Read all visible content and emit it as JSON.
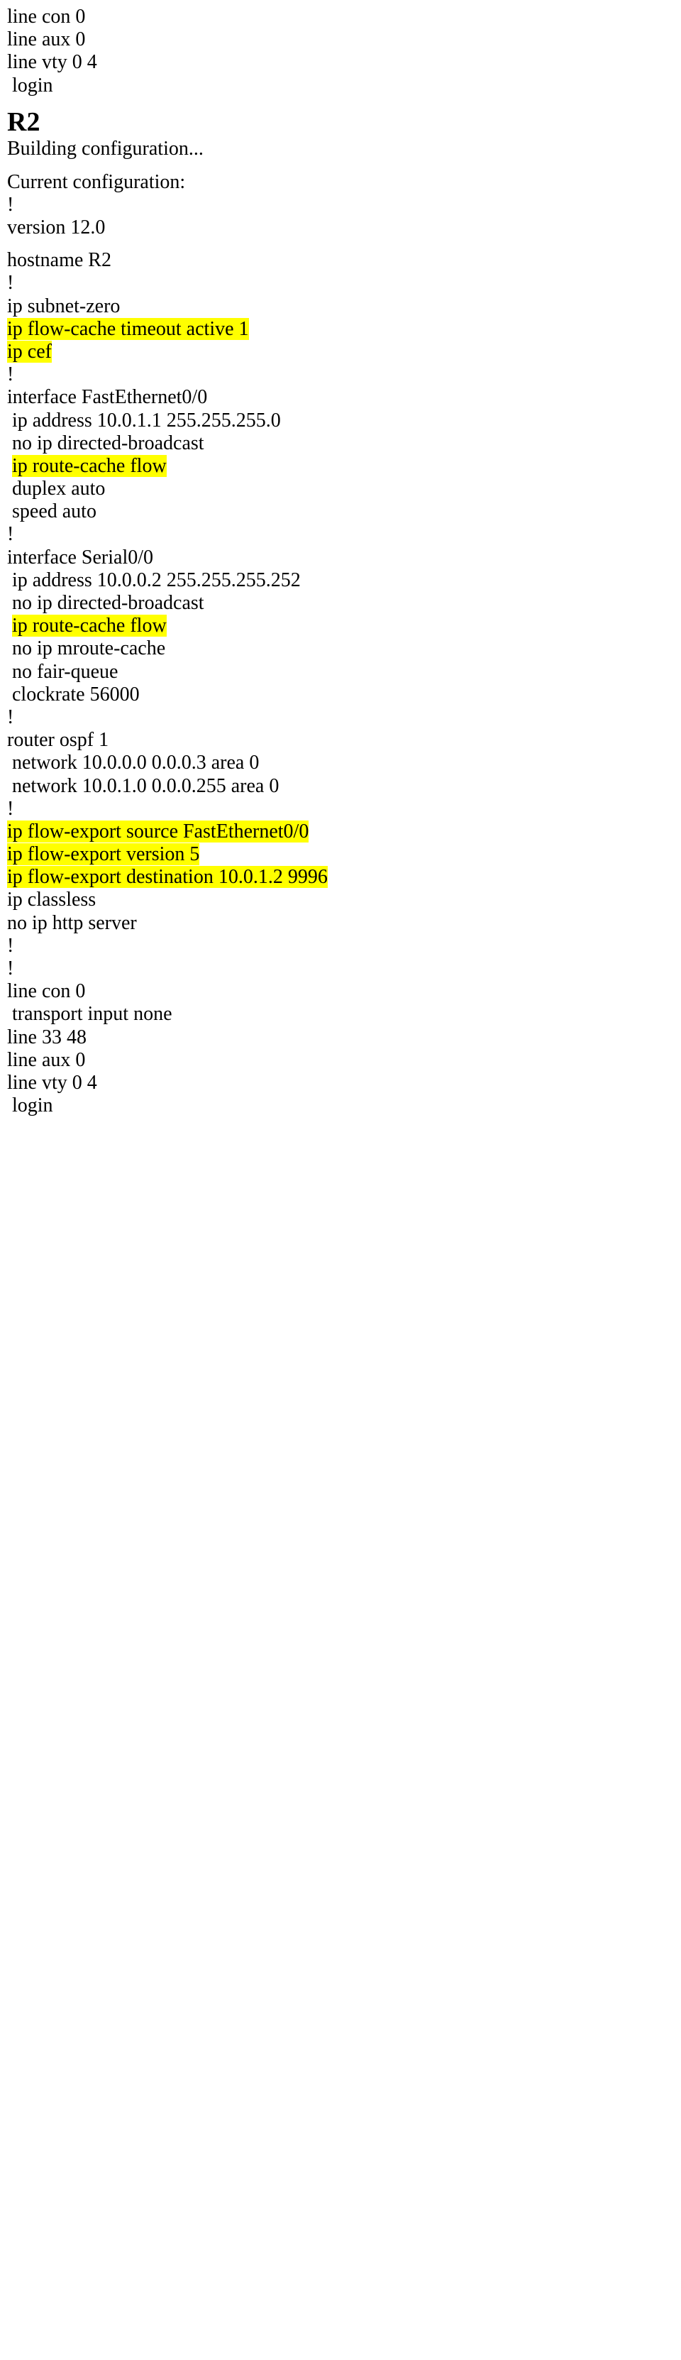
{
  "lines": {
    "l1": "line con 0",
    "l2": "line aux 0",
    "l3": "line vty 0 4",
    "l4": " login",
    "r2": "R2",
    "l5": "Building configuration...",
    "l6": "Current configuration:",
    "l7": "!",
    "l8": "version 12.0",
    "l9": "hostname R2",
    "l10": "!",
    "l11": "ip subnet-zero",
    "l12": "ip flow-cache timeout active 1",
    "l13": "ip cef",
    "l14": "!",
    "l15": "interface FastEthernet0/0",
    "l16": " ip address 10.0.1.1 255.255.255.0",
    "l17": " no ip directed-broadcast",
    "l18_pre": " ",
    "l18": "ip route-cache flow",
    "l19": " duplex auto",
    "l20": " speed auto",
    "l21": "!",
    "l22": "interface Serial0/0",
    "l23": " ip address 10.0.0.2 255.255.255.252",
    "l24": " no ip directed-broadcast",
    "l25_pre": " ",
    "l25": "ip route-cache flow",
    "l26": " no ip mroute-cache",
    "l27": " no fair-queue",
    "l28": " clockrate 56000",
    "l29": "!",
    "l30": "router ospf 1",
    "l31": " network 10.0.0.0 0.0.0.3 area 0",
    "l32": " network 10.0.1.0 0.0.0.255 area 0",
    "l33": "!",
    "l34": "ip flow-export source FastEthernet0/0",
    "l35": "ip flow-export version 5",
    "l36": "ip flow-export destination 10.0.1.2 9996",
    "l37": "ip classless",
    "l38": "no ip http server",
    "l39": "!",
    "l40": "!",
    "l41": "line con 0",
    "l42": " transport input none",
    "l43": "line 33 48",
    "l44": "line aux 0",
    "l45": "line vty 0 4",
    "l46": " login"
  }
}
